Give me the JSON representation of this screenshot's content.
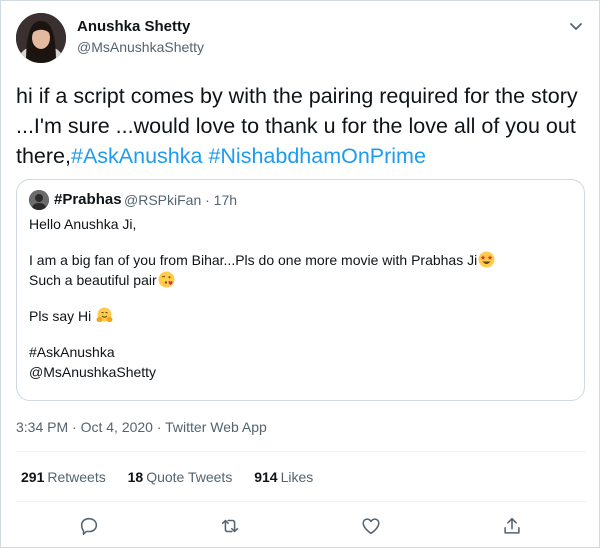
{
  "author": {
    "name": "Anushka Shetty",
    "handle": "@MsAnushkaShetty"
  },
  "tweet": {
    "text_plain": "hi if a script comes by with the pairing required for the story ...I'm sure ...would love to thank u for the love all of you out there,",
    "hashtags": [
      "#AskAnushka",
      "#NishabdhamOnPrime"
    ]
  },
  "quote": {
    "name": "#Prabhas",
    "handle": "@RSPkiFan",
    "time": "· 17h",
    "lines": {
      "l1": "Hello Anushka Ji,",
      "l2": "I am a big fan of you from Bihar...Pls do one more movie with Prabhas Ji",
      "l3": "Such a beautiful pair",
      "l4": "Pls say Hi",
      "l5": "#AskAnushka",
      "l6": "@MsAnushkaShetty"
    },
    "emoji": {
      "l2": "star-struck",
      "l3": "face-blowing-kiss",
      "l4": "hugging-face"
    }
  },
  "meta": {
    "timestamp": "3:34 PM · Oct 4, 2020 · Twitter Web App"
  },
  "stats": {
    "retweets_count": "291",
    "retweets_label": "Retweets",
    "quotes_count": "18",
    "quotes_label": "Quote Tweets",
    "likes_count": "914",
    "likes_label": "Likes"
  },
  "icons": {
    "more": "chevron-down-icon",
    "reply": "reply-icon",
    "retweet": "retweet-icon",
    "like": "heart-icon",
    "share": "share-icon"
  },
  "colors": {
    "link": "#1d9bf0",
    "text": "#0f1419",
    "secondary": "#536471",
    "border": "#cfd9de"
  }
}
